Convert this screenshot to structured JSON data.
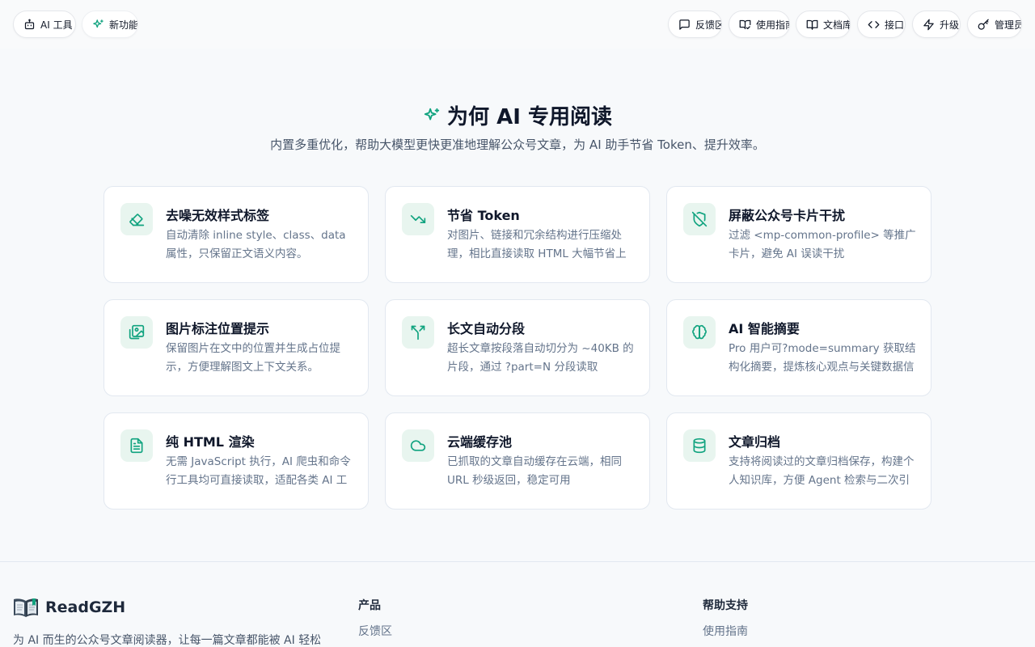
{
  "nav": {
    "left": [
      {
        "label": "AI 工具",
        "icon": "robot-icon"
      },
      {
        "label": "新功能",
        "icon": "sparkles-icon"
      }
    ],
    "right": [
      {
        "label": "反馈区",
        "icon": "message-icon"
      },
      {
        "label": "使用指南",
        "icon": "book-open-check-icon"
      },
      {
        "label": "文档库",
        "icon": "book-open-icon"
      },
      {
        "label": "接口",
        "icon": "code-icon"
      },
      {
        "label": "升级",
        "icon": "zap-icon"
      },
      {
        "label": "管理员",
        "icon": "key-icon"
      }
    ]
  },
  "hero": {
    "title": "为何 AI 专用阅读",
    "subtitle": "内置多重优化，帮助大模型更快更准地理解公众号文章，为 AI 助手节省 Token、提升效率。"
  },
  "features": [
    {
      "title": "去噪无效样式标签",
      "desc": "自动清除 inline style、class、data 属性，只保留正文语义内容。",
      "icon": "eraser-icon"
    },
    {
      "title": "节省 Token",
      "desc": "对图片、链接和冗余结构进行压缩处理，相比直接读取 HTML 大幅节省上下文 AI 调用成本",
      "icon": "trending-down-icon"
    },
    {
      "title": "屏蔽公众号卡片干扰",
      "desc": "过滤 <mp-common-profile> 等推广卡片，避免 AI 误读干扰",
      "icon": "shield-off-icon"
    },
    {
      "title": "图片标注位置提示",
      "desc": "保留图片在文中的位置并生成占位提示，方便理解图文上下文关系。",
      "icon": "image-icon"
    },
    {
      "title": "长文自动分段",
      "desc": "超长文章按段落自动切分为 ~40KB 的片段，通过 ?part=N 分段读取",
      "icon": "split-icon"
    },
    {
      "title": "AI 智能摘要",
      "desc": "Pro 用户可?mode=summary 获取结构化摘要，提炼核心观点与关键数据信息",
      "icon": "brain-icon"
    },
    {
      "title": "纯 HTML 渲染",
      "desc": "无需 JavaScript 执行，AI 爬虫和命令行工具均可直接读取，适配各类 AI 工具",
      "icon": "file-text-icon"
    },
    {
      "title": "云端缓存池",
      "desc": "已抓取的文章自动缓存在云端，相同 URL 秒级返回，稳定可用",
      "icon": "cloud-icon"
    },
    {
      "title": "文章归档",
      "desc": "支持将阅读过的文章归档保存，构建个人知识库，方便 Agent 检索与二次引用",
      "icon": "database-icon"
    }
  ],
  "footer": {
    "brand": "ReadGZH",
    "desc": "为 AI 而生的公众号文章阅读器，让每一篇文章都能被 AI 轻松理解和引用",
    "col1_title": "产品",
    "col1_link": "反馈区",
    "col2_title": "帮助支持",
    "col2_link": "使用指南"
  },
  "colors": {
    "accent": "#10a37f",
    "icon_bg": "#e8f5ef",
    "text_dark": "#0f172a",
    "text_muted": "#64748b"
  }
}
